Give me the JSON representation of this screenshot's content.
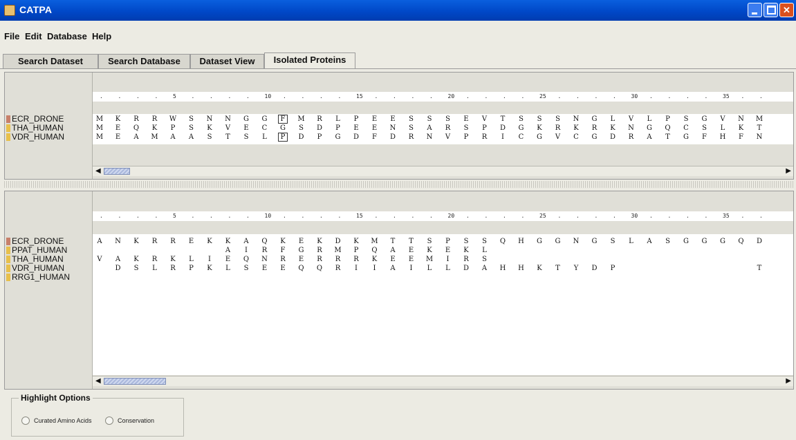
{
  "window": {
    "title": "CATPA"
  },
  "menu": [
    "File",
    "Edit",
    "Database",
    "Help"
  ],
  "tabs": [
    "Search Dataset",
    "Search Database",
    "Dataset View",
    "Isolated Proteins"
  ],
  "active_tab": "Isolated Proteins",
  "ruler_labels": [
    "5",
    "10",
    "15",
    "20",
    "25",
    "30",
    "35"
  ],
  "top_panel": {
    "rows": [
      {
        "name": "ECR_DRONE",
        "color": "#c8806a",
        "residues": [
          "M",
          "K",
          "R",
          "R",
          "W",
          "S",
          "N",
          "N",
          "G",
          "G",
          "F",
          "M",
          "R",
          "L",
          "P",
          "E",
          "E",
          "S",
          "S",
          "S",
          "E",
          "V",
          "T",
          "S",
          "S",
          "S",
          "N",
          "G",
          "L",
          "V",
          "L",
          "P",
          "S",
          "G",
          "V",
          "N",
          "M"
        ]
      },
      {
        "name": "THA_HUMAN",
        "color": "#e8c04a",
        "residues": [
          "M",
          "E",
          "Q",
          "K",
          "P",
          "S",
          "K",
          "V",
          "E",
          "C",
          "G",
          "S",
          "D",
          "P",
          "E",
          "E",
          "N",
          "S",
          "A",
          "R",
          "S",
          "P",
          "D",
          "G",
          "K",
          "R",
          "K",
          "R",
          "K",
          "N",
          "G",
          "Q",
          "C",
          "S",
          "L",
          "K",
          "T"
        ]
      },
      {
        "name": "VDR_HUMAN",
        "color": "#e8c04a",
        "residues": [
          "M",
          "E",
          "A",
          "M",
          "A",
          "A",
          "S",
          "T",
          "S",
          "L",
          "P",
          "D",
          "P",
          "G",
          "D",
          "F",
          "D",
          "R",
          "N",
          "V",
          "P",
          "R",
          "I",
          "C",
          "G",
          "V",
          "C",
          "G",
          "D",
          "R",
          "A",
          "T",
          "G",
          "F",
          "H",
          "F",
          "N"
        ]
      }
    ],
    "boxed_column": 11
  },
  "bottom_panel": {
    "rows": [
      {
        "name": "ECR_DRONE",
        "color": "#c8806a",
        "residues": [
          "A",
          "N",
          "K",
          "R",
          "R",
          "E",
          "K",
          "K",
          "A",
          "Q",
          "K",
          "E",
          "K",
          "D",
          "K",
          "M",
          "T",
          "T",
          "S",
          "P",
          "S",
          "S",
          "Q",
          "H",
          "G",
          "G",
          "N",
          "G",
          "S",
          "L",
          "A",
          "S",
          "G",
          "G",
          "G",
          "Q",
          "D"
        ]
      },
      {
        "name": "PPAT_HUMAN",
        "color": "#e8c04a",
        "residues": [
          "",
          "",
          "",
          "",
          "",
          "",
          "",
          "A",
          "I",
          "R",
          "F",
          "G",
          "R",
          "M",
          "P",
          "Q",
          "A",
          "E",
          "K",
          "E",
          "K",
          "L",
          "",
          "",
          "",
          "",
          "",
          "",
          "",
          "",
          "",
          "",
          "",
          "",
          "",
          "",
          ""
        ]
      },
      {
        "name": "THA_HUMAN",
        "color": "#e8c04a",
        "residues": [
          "V",
          "A",
          "K",
          "R",
          "K",
          "L",
          "I",
          "E",
          "Q",
          "N",
          "R",
          "E",
          "R",
          "R",
          "R",
          "K",
          "E",
          "E",
          "M",
          "I",
          "R",
          "S",
          "",
          "",
          "",
          "",
          "",
          "",
          "",
          "",
          "",
          "",
          "",
          "",
          "",
          "",
          ""
        ]
      },
      {
        "name": "VDR_HUMAN",
        "color": "#e8c04a",
        "residues": [
          "",
          "D",
          "S",
          "L",
          "R",
          "P",
          "K",
          "L",
          "S",
          "E",
          "E",
          "Q",
          "Q",
          "R",
          "I",
          "I",
          "A",
          "I",
          "L",
          "L",
          "D",
          "A",
          "H",
          "H",
          "K",
          "T",
          "Y",
          "D",
          "P",
          "",
          "",
          "",
          "",
          "",
          "",
          "",
          "T"
        ]
      },
      {
        "name": "RRG1_HUMAN",
        "color": "#e8c04a",
        "residues": []
      }
    ]
  },
  "highlight_options": {
    "title": "Highlight Options",
    "options": [
      "Curated Amino Acids",
      "Conservation"
    ]
  }
}
